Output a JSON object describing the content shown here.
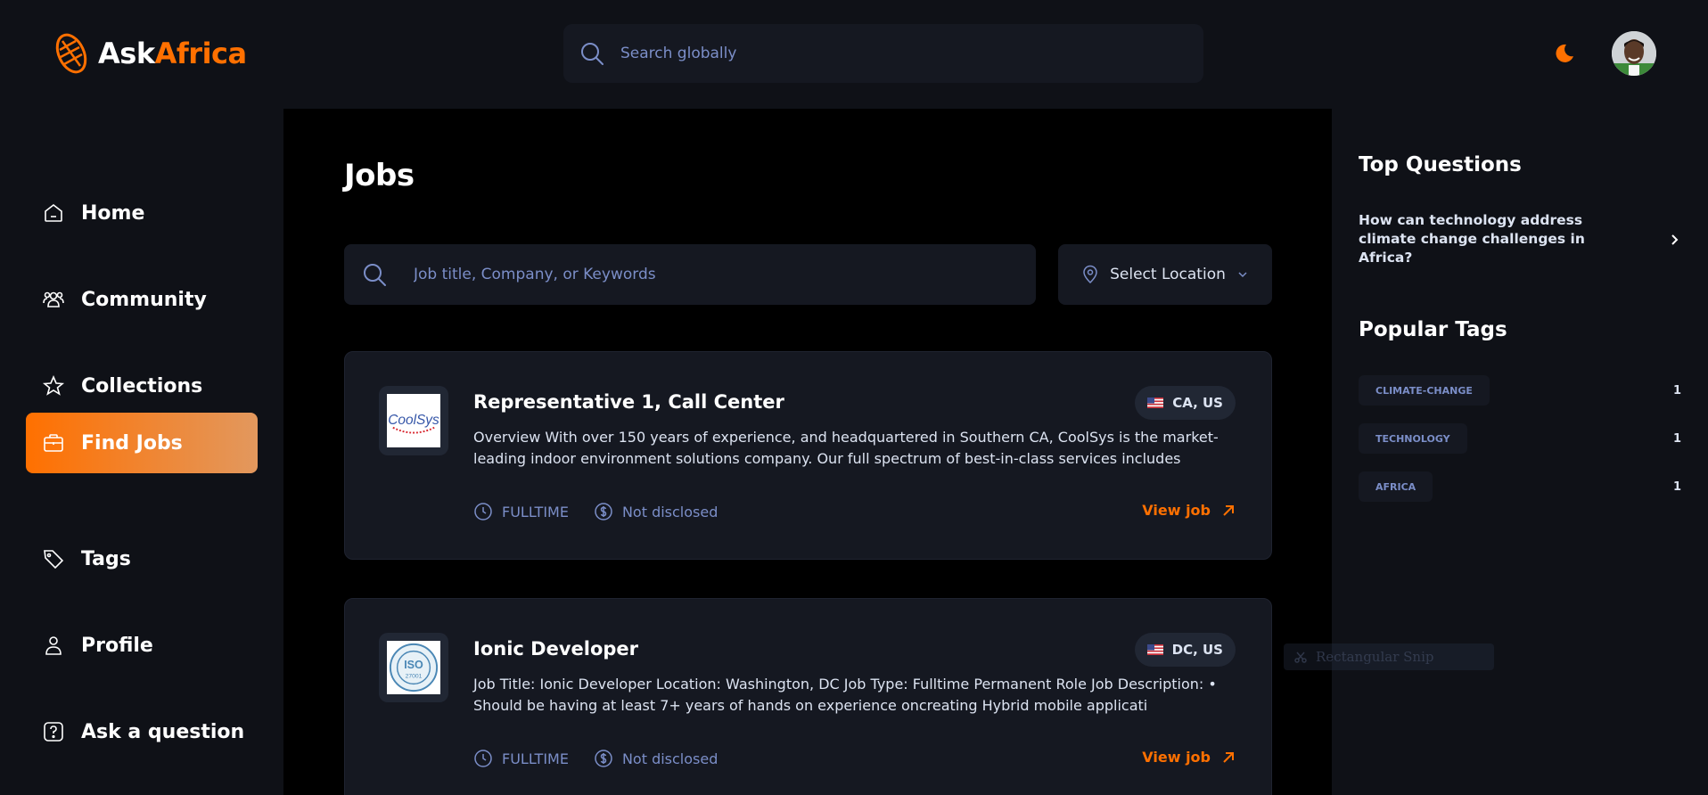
{
  "app": {
    "logo_part1": "Ask",
    "logo_part2": "Africa",
    "search_placeholder": "Search globally"
  },
  "colors": {
    "accent": "#ff7000",
    "background": "#0f1117",
    "card": "#151821",
    "muted": "#7b8ec8"
  },
  "sidebar": {
    "items": [
      {
        "label": "Home",
        "icon": "home-icon",
        "active": false
      },
      {
        "label": "Community",
        "icon": "users-icon",
        "active": false
      },
      {
        "label": "Collections",
        "icon": "star-icon",
        "active": false
      },
      {
        "label": "Find Jobs",
        "icon": "briefcase-icon",
        "active": true
      },
      {
        "label": "Tags",
        "icon": "tag-icon",
        "active": false
      },
      {
        "label": "Profile",
        "icon": "user-icon",
        "active": false
      },
      {
        "label": "Ask a question",
        "icon": "question-icon",
        "active": false
      }
    ]
  },
  "main": {
    "title": "Jobs",
    "search_placeholder": "Job title, Company, or Keywords",
    "location_label": "Select Location",
    "jobs": [
      {
        "title": "Representative 1, Call Center",
        "description": "Overview With over 150 years of experience, and headquartered in Southern CA, CoolSys is the market-leading indoor environment solutions company. Our full spectrum of best-in-class services includes",
        "location": "CA, US",
        "type": "FULLTIME",
        "salary": "Not disclosed",
        "cta": "View job",
        "company_logo_text": "CoolSys"
      },
      {
        "title": "Ionic Developer",
        "description": "Job Title: Ionic Developer Location: Washington, DC Job Type: Fulltime Permanent Role Job Description: • Should be having at least 7+ years of hands on experience oncreating Hybrid mobile applicati",
        "location": "DC, US",
        "type": "FULLTIME",
        "salary": "Not disclosed",
        "cta": "View job",
        "company_logo_text": "ISO 27001"
      }
    ]
  },
  "rightbar": {
    "top_questions_title": "Top Questions",
    "questions": [
      {
        "text": "How can technology address climate change challenges in Africa?"
      }
    ],
    "popular_tags_title": "Popular Tags",
    "tags": [
      {
        "name": "CLIMATE-CHANGE",
        "count": "1"
      },
      {
        "name": "TECHNOLOGY",
        "count": "1"
      },
      {
        "name": "AFRICA",
        "count": "1"
      }
    ]
  },
  "ghost_text": "Rectangular Snip"
}
